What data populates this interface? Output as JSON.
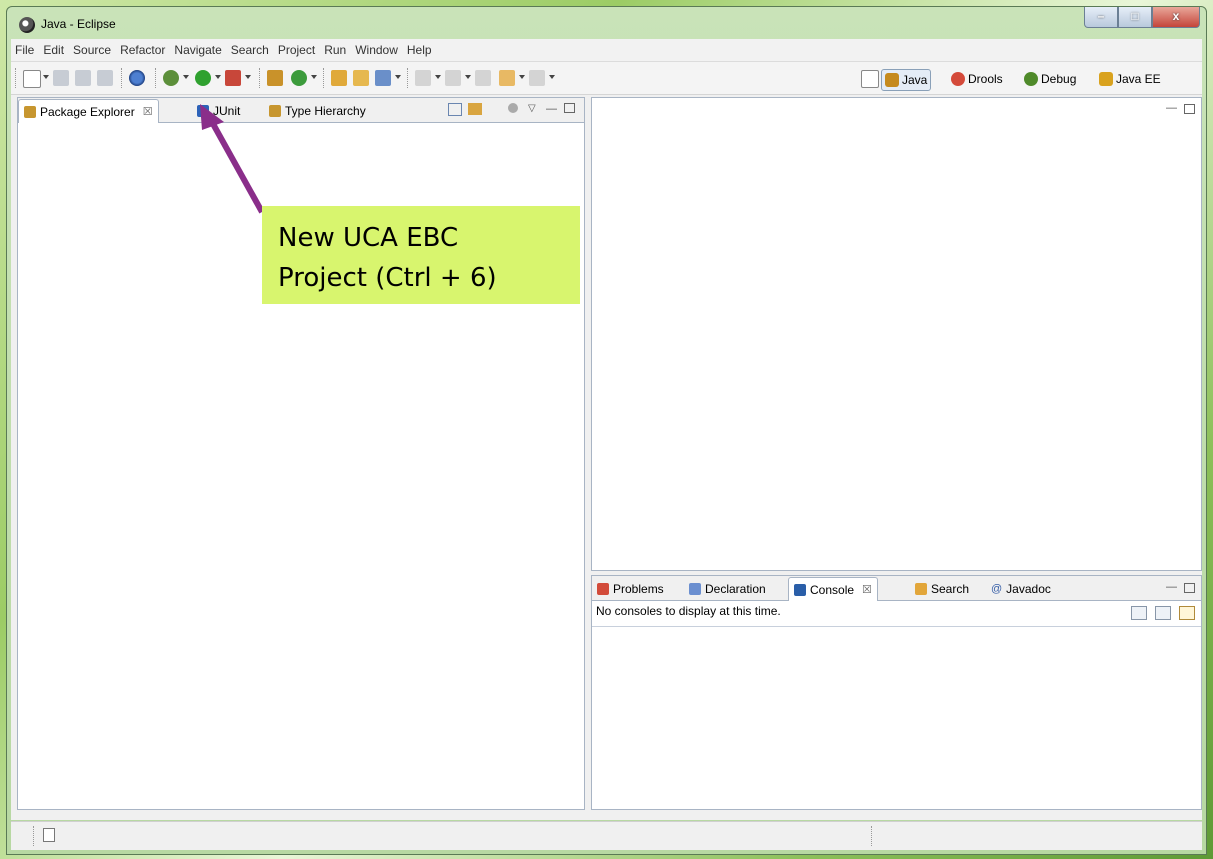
{
  "window": {
    "title": "Java - Eclipse",
    "minimize_glyph": "–",
    "maximize_glyph": "□",
    "close_glyph": "x"
  },
  "menu": [
    "File",
    "Edit",
    "Source",
    "Refactor",
    "Navigate",
    "Search",
    "Project",
    "Run",
    "Window",
    "Help"
  ],
  "perspectives": [
    {
      "label": "Java",
      "selected": true,
      "icon": "java-perspective-icon",
      "color": "#c58a1e"
    },
    {
      "label": "Drools",
      "selected": false,
      "icon": "drools-icon",
      "color": "#d44a3a"
    },
    {
      "label": "Debug",
      "selected": false,
      "icon": "debug-bug-icon",
      "color": "#4f8a2a"
    },
    {
      "label": "Java EE",
      "selected": false,
      "icon": "java-ee-icon",
      "color": "#d9a21e"
    }
  ],
  "left_panel": {
    "tabs": [
      {
        "label": "Package Explorer",
        "close": "☒",
        "active": true
      },
      {
        "label": "JUnit",
        "close": "",
        "active": false
      },
      {
        "label": "Type Hierarchy",
        "close": "",
        "active": false
      }
    ]
  },
  "bottom_panel": {
    "tabs": [
      {
        "label": "Problems",
        "close": "",
        "active": false
      },
      {
        "label": "Declaration",
        "close": "",
        "active": false
      },
      {
        "label": "Console",
        "close": "☒",
        "active": true
      },
      {
        "label": "Search",
        "close": "",
        "active": false
      },
      {
        "label": "Javadoc",
        "close": "",
        "active": false
      }
    ],
    "console_message": "No consoles to display at this time."
  },
  "callout": {
    "text": "New UCA EBC\nProject (Ctrl + 6)",
    "color": "#d8f56e",
    "arrow_color": "#8a2e8a"
  }
}
